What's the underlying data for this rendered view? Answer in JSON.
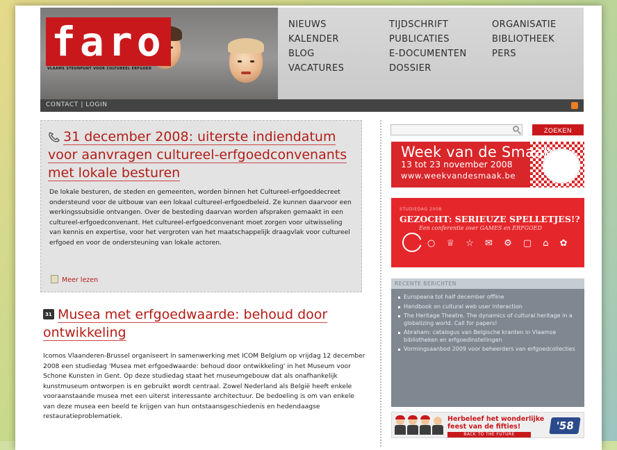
{
  "header": {
    "logo_text": "faro",
    "logo_tagline": "VLAAMS STEUNPUNT VOOR CULTUREEL ERFGOED",
    "nav_columns": [
      [
        "NIEUWS",
        "KALENDER",
        "BLOG",
        "VACATURES"
      ],
      [
        "TIJDSCHRIFT",
        "PUBLICATIES",
        "E-DOCUMENTEN",
        "DOSSIER"
      ],
      [
        "ORGANISATIE",
        "BIBLIOTHEEK",
        "PERS"
      ]
    ],
    "utility_links": "CONTACT | LOGIN",
    "icons": {
      "feed": "rss-icon"
    },
    "colors": {
      "brand": "#c8181c",
      "bar": "#434343"
    }
  },
  "articles": [
    {
      "icon": "phone-icon",
      "title": "31 december 2008: uiterste indiendatum voor aanvragen cultureel-erfgoedconvenants met lokale besturen",
      "body": "De lokale besturen, de steden en gemeenten, worden binnen het Cultureel-erfgoeddecreet ondersteund voor de uitbouw van een lokaal cultureel-erfgoedbeleid. Ze kunnen daarvoor een werkingssubsidie ontvangen. Over de besteding daarvan worden afspraken gemaakt in een cultureel-erfgoedconvenant. Het cultureel-erfgoedconvenant moet zorgen voor uitwisseling van kennis en expertise, voor het vergroten van het maatschappelijk draagvlak voor cultureel erfgoed en voor de ondersteuning van lokale actoren.",
      "more_label": "Meer lezen"
    },
    {
      "icon": "calendar-icon",
      "icon_text": "31",
      "title": "Musea met erfgoedwaarde: behoud door ontwikkeling",
      "body": "Icomos Vlaanderen-Brussel organiseert in samenwerking met ICOM Belgium op vrijdag 12 december 2008 een studiedag 'Musea met erfgoedwaarde: behoud door ontwikkeling' in het Museum voor Schone Kunsten in Gent. Op deze studiedag staat het museumgebouw dat als onafhankelijk kunstmuseum ontworpen is en gebruikt wordt centraal. Zowel Nederland als België heeft enkele vooraanstaande musea met een uiterst interessante architectuur. De bedoeling is om van enkele van deze musea een beeld te krijgen van hun ontstaansgeschiedenis en hedendaagse restauratieproblematiek."
    }
  ],
  "sidebar": {
    "search": {
      "placeholder": "",
      "button_label": "ZOEKEN"
    },
    "banner_smaak": {
      "title": "Week van de Smaak",
      "dates": "13 tot 23 november 2008",
      "url": "www.weekvandesmaak.be"
    },
    "banner_spel": {
      "label": "STUDIEDAG 2008",
      "title": "GEZOCHT: SERIEUZE SPELLETJES!?",
      "subtitle": "Een conferentie over GAMES en ERFGOED",
      "icons_text": "○ ♕ ☆ ✉ ⚙ ▢ ⌂ ✿"
    },
    "recent": {
      "heading": "RECENTE BERICHTEN",
      "items": [
        "Europeana tot half december offline",
        "Handbook on cultural web user interaction",
        "The Heritage Theatre. The dynamics of cultural heritage in a globalizing world. Call for papers!",
        "Abraham: catalogus van Belgische kranten in Vlaamse bibliotheken en erfgoedinstellingen",
        "Vormingsaanbod 2009 voor beheerders van erfgoedcollecties"
      ]
    },
    "banner_fifties": {
      "text": "Herbeleef het wonderlijke feest van de fifties!",
      "ribbon": "BACK TO THE FUTURE",
      "badge": "'58"
    }
  }
}
